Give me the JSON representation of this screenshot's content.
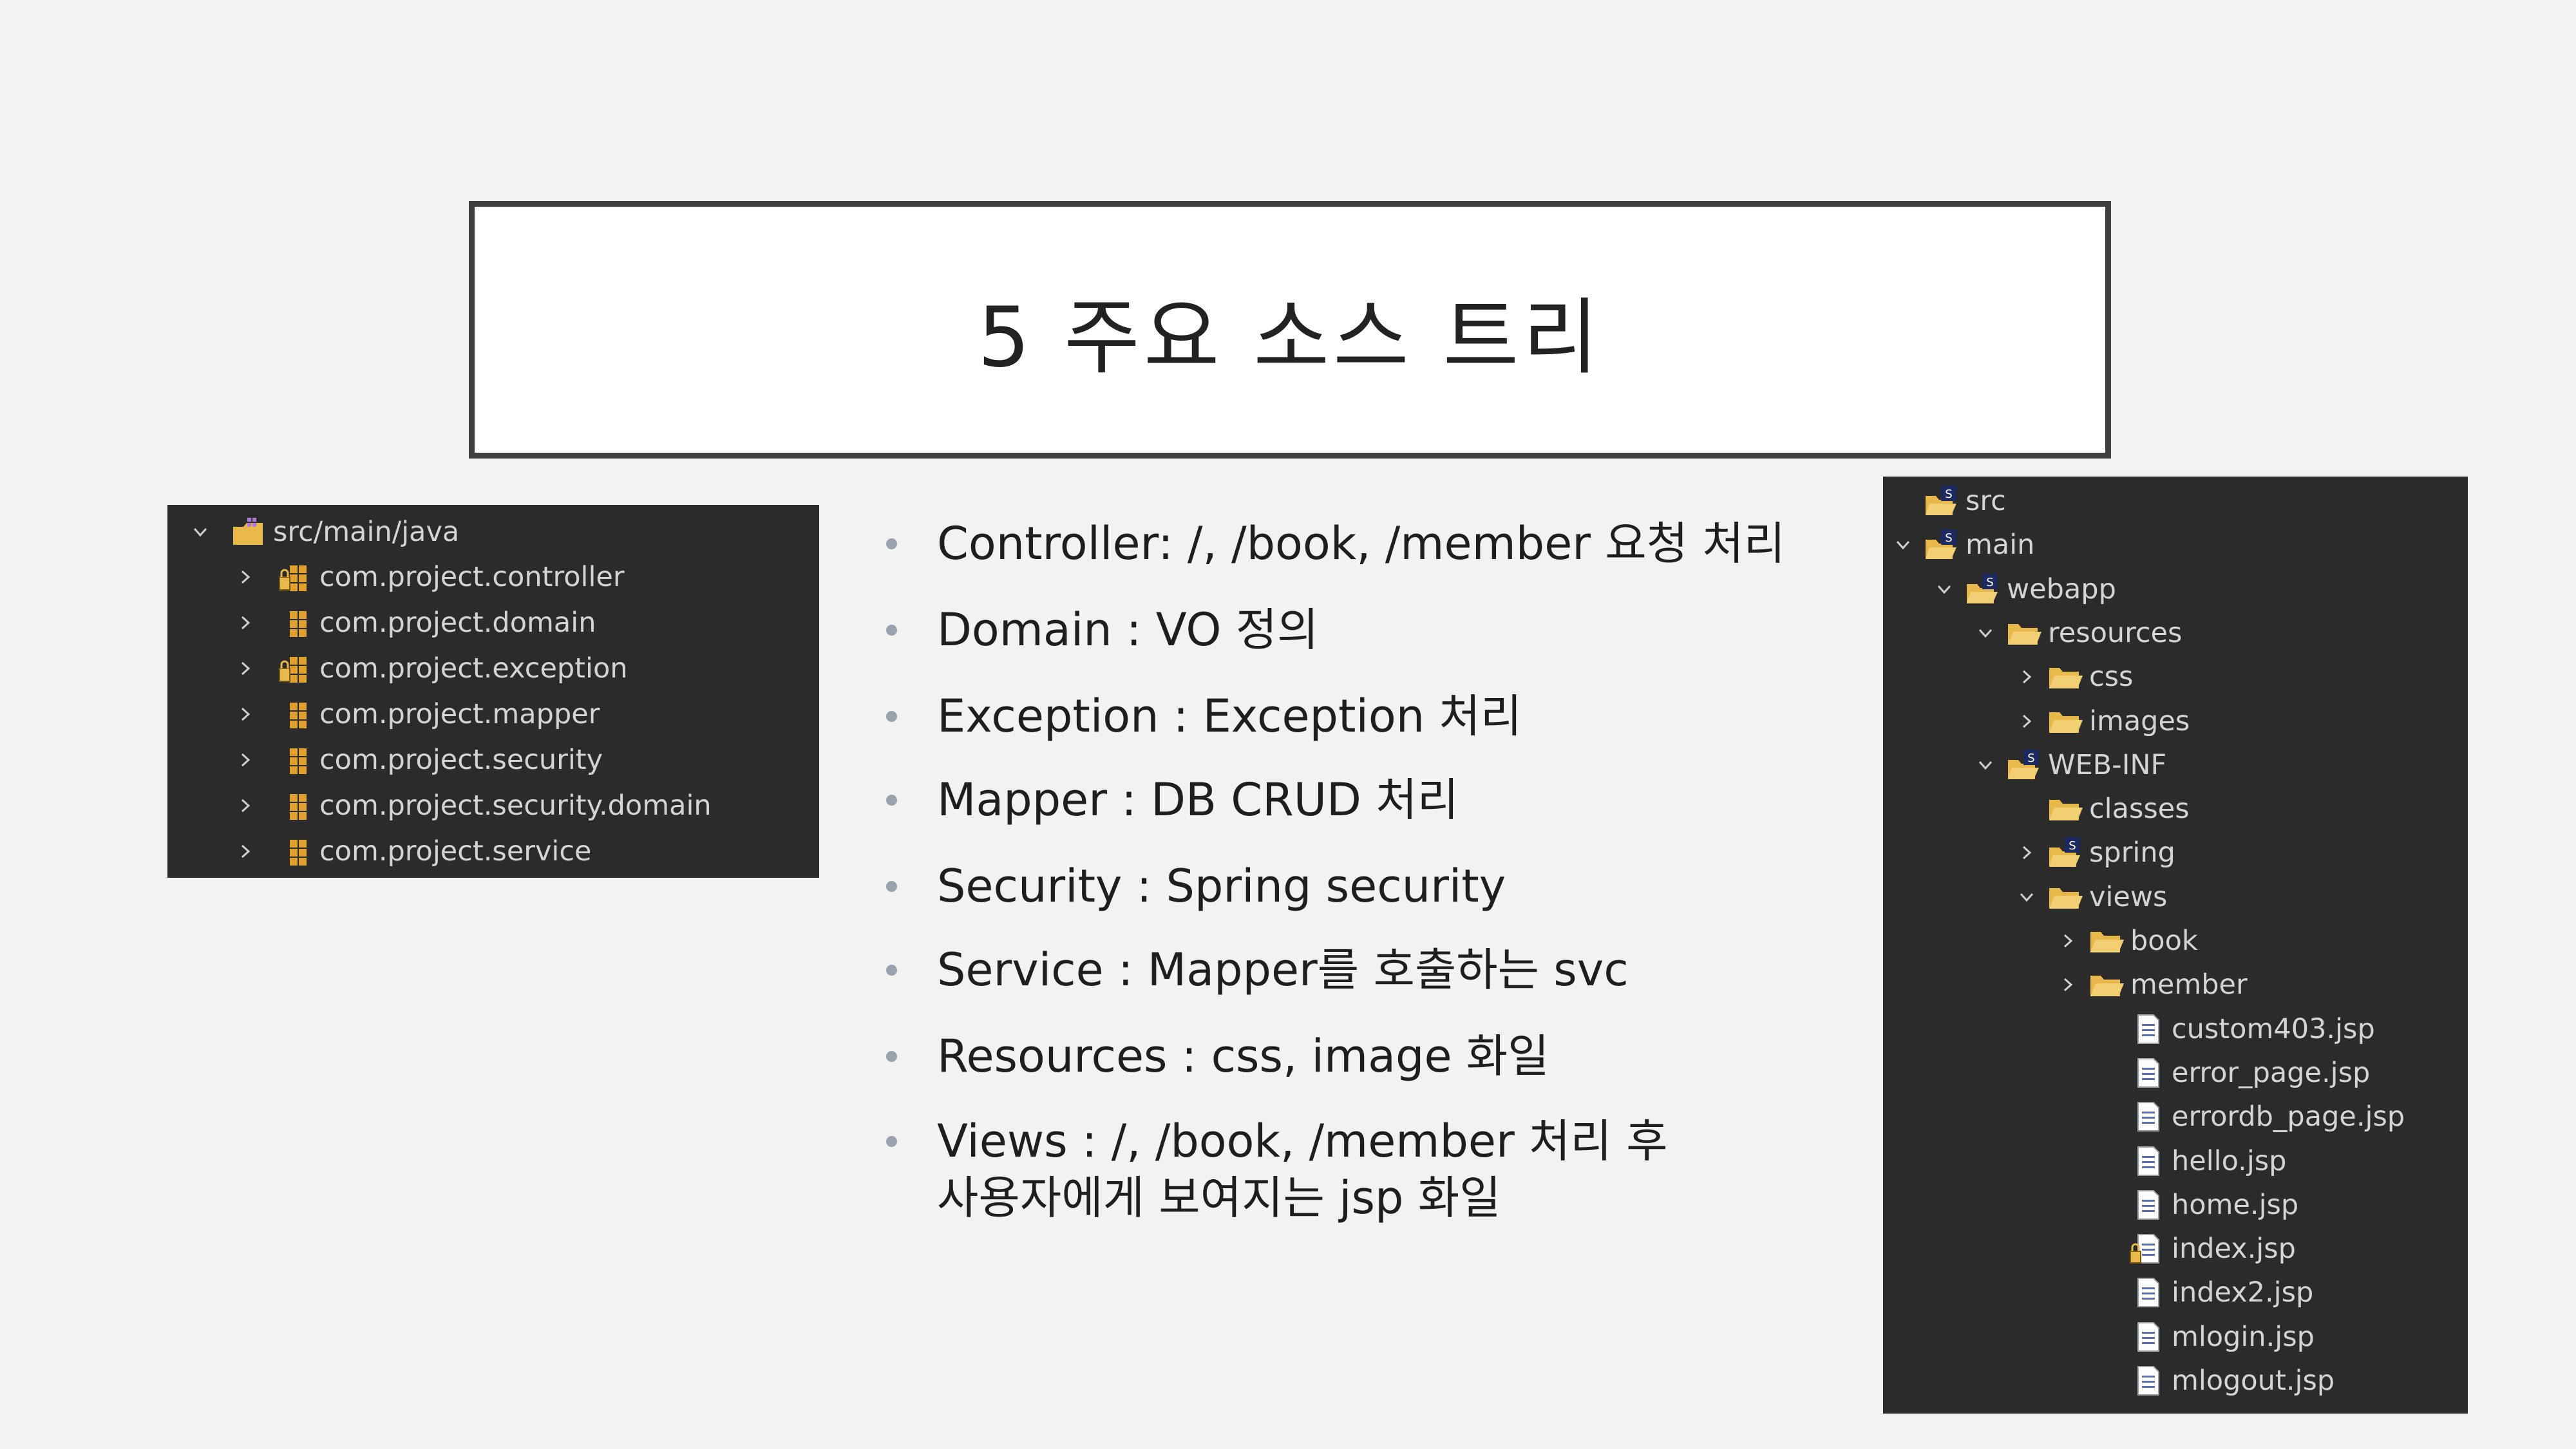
{
  "slide": {
    "title": "5 주요 소스 트리"
  },
  "package_tree": {
    "root": "src/main/java",
    "items": [
      {
        "label": "com.project.controller",
        "icon": "package-linked-icon"
      },
      {
        "label": "com.project.domain",
        "icon": "package-icon"
      },
      {
        "label": "com.project.exception",
        "icon": "package-linked-icon"
      },
      {
        "label": "com.project.mapper",
        "icon": "package-icon"
      },
      {
        "label": "com.project.security",
        "icon": "package-icon"
      },
      {
        "label": "com.project.security.domain",
        "icon": "package-icon"
      },
      {
        "label": "com.project.service",
        "icon": "package-icon"
      }
    ]
  },
  "bullets": [
    {
      "text": "Controller:  /,  /book,  /member 요청 처리"
    },
    {
      "text": "Domain : VO 정의"
    },
    {
      "text": "Exception : Exception 처리"
    },
    {
      "text": "Mapper : DB CRUD 처리"
    },
    {
      "text": "Security : Spring security"
    },
    {
      "text": "Service : Mapper를 호출하는 svc"
    },
    {
      "text": "Resources : css, image 화일"
    },
    {
      "text": "Views :  /,  /book,  /member 처리 후",
      "text2": "사용자에게 보여지는 jsp 화일"
    }
  ],
  "file_tree": {
    "items": [
      {
        "label": "src",
        "icon": "spring-folder-icon",
        "chevron": "none"
      },
      {
        "label": "main",
        "icon": "spring-folder-icon",
        "chevron": "down"
      },
      {
        "label": "webapp",
        "icon": "spring-folder-icon",
        "chevron": "down"
      },
      {
        "label": "resources",
        "icon": "folder-icon",
        "chevron": "down"
      },
      {
        "label": "css",
        "icon": "folder-icon",
        "chevron": "right"
      },
      {
        "label": "images",
        "icon": "folder-icon",
        "chevron": "right"
      },
      {
        "label": "WEB-INF",
        "icon": "spring-folder-icon",
        "chevron": "down"
      },
      {
        "label": "classes",
        "icon": "folder-icon",
        "chevron": "none"
      },
      {
        "label": "spring",
        "icon": "spring-folder-icon",
        "chevron": "right"
      },
      {
        "label": "views",
        "icon": "folder-icon",
        "chevron": "down"
      },
      {
        "label": "book",
        "icon": "folder-icon",
        "chevron": "right"
      },
      {
        "label": "member",
        "icon": "folder-icon",
        "chevron": "right"
      },
      {
        "label": "custom403.jsp",
        "icon": "jsp-file-icon",
        "chevron": "none"
      },
      {
        "label": "error_page.jsp",
        "icon": "jsp-file-icon",
        "chevron": "none"
      },
      {
        "label": "errordb_page.jsp",
        "icon": "jsp-file-icon",
        "chevron": "none"
      },
      {
        "label": "hello.jsp",
        "icon": "jsp-file-icon",
        "chevron": "none"
      },
      {
        "label": "home.jsp",
        "icon": "jsp-file-icon",
        "chevron": "none"
      },
      {
        "label": "index.jsp",
        "icon": "jsp-file-linked-icon",
        "chevron": "none"
      },
      {
        "label": "index2.jsp",
        "icon": "jsp-file-icon",
        "chevron": "none"
      },
      {
        "label": "mlogin.jsp",
        "icon": "jsp-file-icon",
        "chevron": "none"
      },
      {
        "label": "mlogout.jsp",
        "icon": "jsp-file-icon",
        "chevron": "none"
      }
    ]
  },
  "colors": {
    "slide_background": "#f2f2f2",
    "panel_background": "#2b2b2b",
    "tree_text": "#d4d4d4",
    "folder_yellow": "#e8b94a",
    "package_orange": "#e0a030",
    "bullet_dot": "#9aa3ad"
  }
}
